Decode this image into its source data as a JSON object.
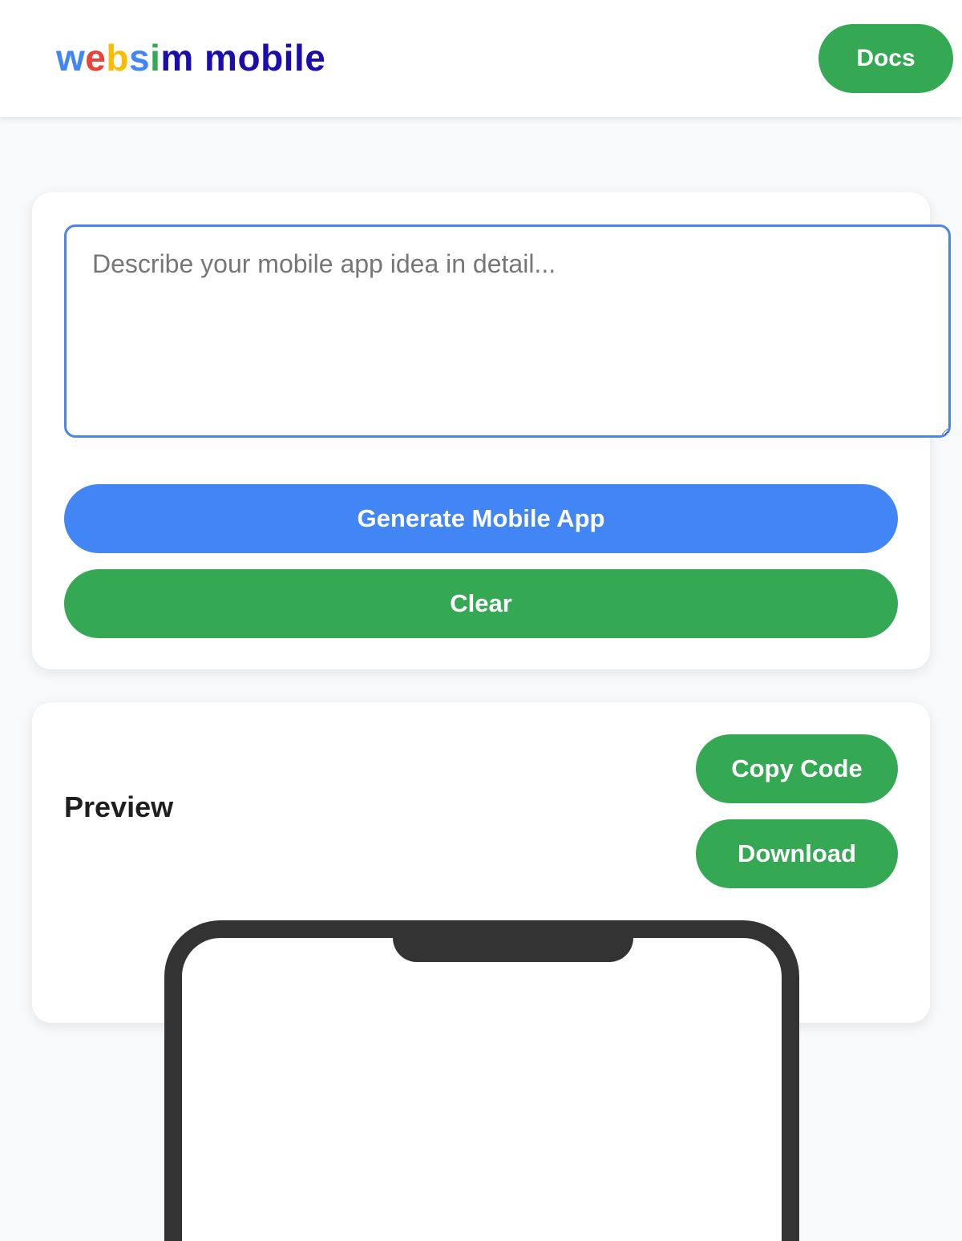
{
  "header": {
    "logo_letters": [
      {
        "char": "w",
        "color": "#4285f4"
      },
      {
        "char": "e",
        "color": "#ea4335"
      },
      {
        "char": "b",
        "color": "#fbbc05"
      },
      {
        "char": "s",
        "color": "#4285f4"
      },
      {
        "char": "i",
        "color": "#34a853"
      },
      {
        "char": "m",
        "color": "#1a0dab"
      },
      {
        "char": " ",
        "color": "#1a0dab"
      },
      {
        "char": "m",
        "color": "#1a0dab"
      },
      {
        "char": "o",
        "color": "#1a0dab"
      },
      {
        "char": "b",
        "color": "#1a0dab"
      },
      {
        "char": "i",
        "color": "#1a0dab"
      },
      {
        "char": "l",
        "color": "#1a0dab"
      },
      {
        "char": "e",
        "color": "#1a0dab"
      }
    ],
    "docs_label": "Docs"
  },
  "input_card": {
    "prompt_placeholder": "Describe your mobile app idea in detail...",
    "prompt_value": "",
    "generate_label": "Generate Mobile App",
    "clear_label": "Clear"
  },
  "preview_card": {
    "title": "Preview",
    "copy_label": "Copy Code",
    "download_label": "Download"
  },
  "colors": {
    "primary_blue": "#4285f4",
    "action_green": "#34a853",
    "focus_border": "#4a86e8",
    "page_background": "#f8f9fa",
    "phone_frame": "#333333"
  }
}
